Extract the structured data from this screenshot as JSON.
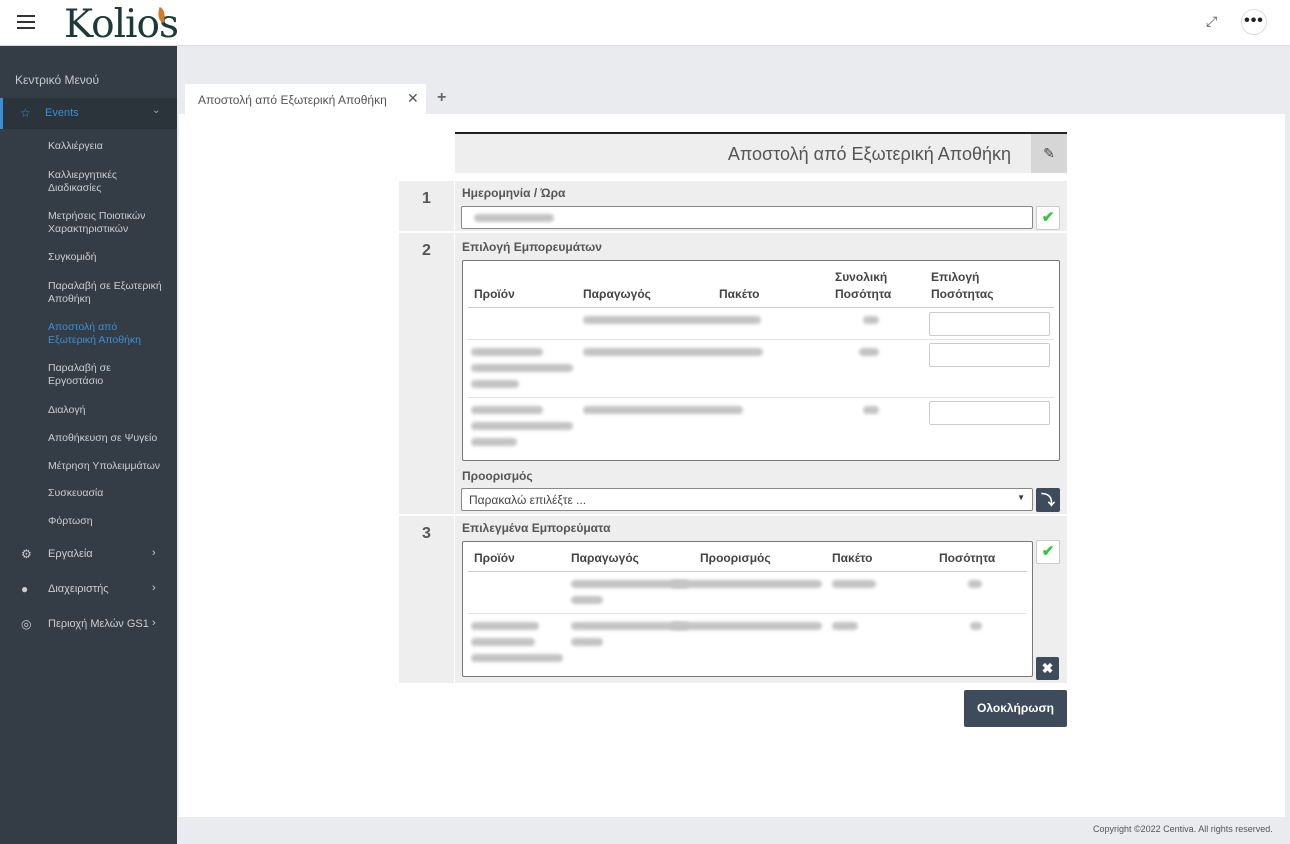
{
  "header": {
    "logo_text": "Kolios",
    "fullscreen_icon": "expand-icon",
    "more_icon": "more-horizontal-icon"
  },
  "sidebar": {
    "menu_title": "Κεντρικό Μενού",
    "events_label": "Events",
    "events_items": [
      "Καλλιέργεια",
      "Καλλιεργητικές Διαδικασίες",
      "Μετρήσεις Ποιοτικών Χαρακτηριστικών",
      "Συγκομιδή",
      "Παραλαβή σε Εξωτερική Αποθήκη",
      "Αποστολή από Εξωτερική Αποθήκη",
      "Παραλαβή σε Εργοστάσιο",
      "Διαλογή",
      "Αποθήκευση σε Ψυγείο",
      "Μέτρηση Υπολειμμάτων",
      "Συσκευασία",
      "Φόρτωση"
    ],
    "groups": [
      "Εργαλεία",
      "Διαχειριστής",
      "Περιοχή Μελών GS1"
    ]
  },
  "tabs": {
    "active_label": "Αποστολή από Εξωτερική Αποθήκη",
    "add_icon": "plus-icon"
  },
  "form": {
    "title": "Αποστολή από Εξωτερική Αποθήκη",
    "step1": {
      "number": "1",
      "label": "Ημερομηνία / Ώρα"
    },
    "step2": {
      "number": "2",
      "label": "Επιλογή Εμπορευμάτων",
      "columns": [
        "Προϊόν",
        "Παραγωγός",
        "Πακέτο",
        "Συνολική Ποσότητα",
        "Επιλογή Ποσότητας"
      ],
      "destination_label": "Προορισμός",
      "destination_placeholder": "Παρακαλώ επιλέξτε ..."
    },
    "step3": {
      "number": "3",
      "label": "Επιλεγμένα Εμπορεύματα",
      "columns": [
        "Προϊόν",
        "Παραγωγός",
        "Προορισμός",
        "Πακέτο",
        "Ποσότητα"
      ]
    },
    "finish_label": "Ολοκλήρωση"
  },
  "footer": {
    "copyright": "Copyright ©2022 Centiva. All rights reserved."
  }
}
